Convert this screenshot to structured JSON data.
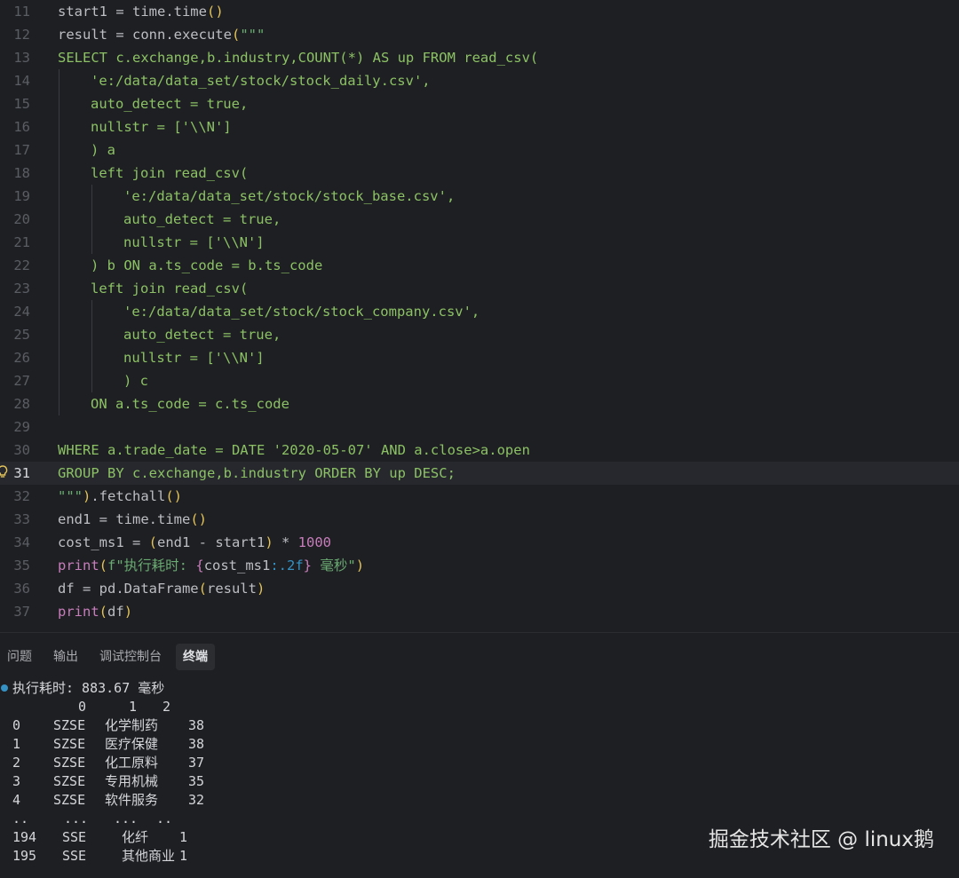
{
  "colors": {
    "keyword": "#cf8e6d",
    "string": "#6aab73",
    "number": "#2aacb8",
    "function": "#56a8f5",
    "paren": "#e3c35a",
    "default": "#bcbec4",
    "sql": "#8cc265",
    "builtin": "#c77dbb",
    "dot": "#3592c4"
  },
  "editor": {
    "lines": [
      {
        "n": "11",
        "indent": 0,
        "segs": [
          {
            "t": "start1 = time.time",
            "c": "default"
          },
          {
            "t": "()",
            "c": "paren"
          }
        ]
      },
      {
        "n": "12",
        "indent": 0,
        "segs": [
          {
            "t": "result = conn.execute",
            "c": "default"
          },
          {
            "t": "(",
            "c": "paren"
          },
          {
            "t": "\"\"\"",
            "c": "string"
          }
        ]
      },
      {
        "n": "13",
        "indent": 0,
        "segs": [
          {
            "t": "SELECT c.exchange,b.industry,COUNT(*) AS up FROM read_csv(",
            "c": "sql"
          }
        ]
      },
      {
        "n": "14",
        "indent": 1,
        "segs": [
          {
            "t": "'e:/data/data_set/stock/stock_daily.csv',",
            "c": "sql"
          }
        ]
      },
      {
        "n": "15",
        "indent": 1,
        "segs": [
          {
            "t": "auto_detect = true,",
            "c": "sql"
          }
        ]
      },
      {
        "n": "16",
        "indent": 1,
        "segs": [
          {
            "t": "nullstr = ['\\\\N']",
            "c": "sql"
          }
        ]
      },
      {
        "n": "17",
        "indent": 1,
        "segs": [
          {
            "t": ") a",
            "c": "sql"
          }
        ]
      },
      {
        "n": "18",
        "indent": 1,
        "segs": [
          {
            "t": "left join read_csv(",
            "c": "sql"
          }
        ]
      },
      {
        "n": "19",
        "indent": 2,
        "segs": [
          {
            "t": "'e:/data/data_set/stock/stock_base.csv',",
            "c": "sql"
          }
        ]
      },
      {
        "n": "20",
        "indent": 2,
        "segs": [
          {
            "t": "auto_detect = true,",
            "c": "sql"
          }
        ]
      },
      {
        "n": "21",
        "indent": 2,
        "segs": [
          {
            "t": "nullstr = ['\\\\N']",
            "c": "sql"
          }
        ]
      },
      {
        "n": "22",
        "indent": 1,
        "segs": [
          {
            "t": ") b ON a.ts_code = b.ts_code",
            "c": "sql"
          }
        ]
      },
      {
        "n": "23",
        "indent": 1,
        "segs": [
          {
            "t": "left join read_csv(",
            "c": "sql"
          }
        ]
      },
      {
        "n": "24",
        "indent": 2,
        "segs": [
          {
            "t": "'e:/data/data_set/stock/stock_company.csv',",
            "c": "sql"
          }
        ]
      },
      {
        "n": "25",
        "indent": 2,
        "segs": [
          {
            "t": "auto_detect = true,",
            "c": "sql"
          }
        ]
      },
      {
        "n": "26",
        "indent": 2,
        "segs": [
          {
            "t": "nullstr = ['\\\\N']",
            "c": "sql"
          }
        ]
      },
      {
        "n": "27",
        "indent": 2,
        "segs": [
          {
            "t": ") c",
            "c": "sql"
          }
        ]
      },
      {
        "n": "28",
        "indent": 1,
        "segs": [
          {
            "t": "ON a.ts_code = c.ts_code",
            "c": "sql"
          }
        ]
      },
      {
        "n": "29",
        "indent": 0,
        "segs": []
      },
      {
        "n": "30",
        "indent": 0,
        "segs": [
          {
            "t": "WHERE a.trade_date = DATE '2020-05-07' AND a.close>a.open",
            "c": "sql"
          }
        ]
      },
      {
        "n": "31",
        "indent": 0,
        "current": true,
        "segs": [
          {
            "t": "GROUP BY c.exchange,b.industry ORDER BY up DESC;",
            "c": "sql"
          }
        ]
      },
      {
        "n": "32",
        "indent": 0,
        "segs": [
          {
            "t": "\"\"\"",
            "c": "string"
          },
          {
            "t": ")",
            "c": "paren"
          },
          {
            "t": ".fetchall",
            "c": "default"
          },
          {
            "t": "()",
            "c": "paren"
          }
        ]
      },
      {
        "n": "33",
        "indent": 0,
        "segs": [
          {
            "t": "end1 = time.time",
            "c": "default"
          },
          {
            "t": "()",
            "c": "paren"
          }
        ]
      },
      {
        "n": "34",
        "indent": 0,
        "segs": [
          {
            "t": "cost_ms1 = ",
            "c": "default"
          },
          {
            "t": "(",
            "c": "paren"
          },
          {
            "t": "end1 - start1",
            "c": "default"
          },
          {
            "t": ")",
            "c": "paren"
          },
          {
            "t": " * ",
            "c": "default"
          },
          {
            "t": "1000",
            "c": "builtin"
          }
        ]
      },
      {
        "n": "35",
        "indent": 0,
        "segs": [
          {
            "t": "print",
            "c": "builtin"
          },
          {
            "t": "(",
            "c": "paren"
          },
          {
            "t": "f\"执行耗时: ",
            "c": "string"
          },
          {
            "t": "{",
            "c": "builtin"
          },
          {
            "t": "cost_ms1",
            "c": "default"
          },
          {
            "t": ":.2f",
            "c": "dot"
          },
          {
            "t": "}",
            "c": "builtin"
          },
          {
            "t": " 毫秒\"",
            "c": "string"
          },
          {
            "t": ")",
            "c": "paren"
          }
        ]
      },
      {
        "n": "36",
        "indent": 0,
        "segs": [
          {
            "t": "df = pd.DataFrame",
            "c": "default"
          },
          {
            "t": "(",
            "c": "paren"
          },
          {
            "t": "result",
            "c": "default"
          },
          {
            "t": ")",
            "c": "paren"
          }
        ]
      },
      {
        "n": "37",
        "indent": 0,
        "segs": [
          {
            "t": "print",
            "c": "builtin"
          },
          {
            "t": "(",
            "c": "paren"
          },
          {
            "t": "df",
            "c": "default"
          },
          {
            "t": ")",
            "c": "paren"
          }
        ]
      }
    ]
  },
  "panel": {
    "tabs": [
      {
        "label": "问题",
        "active": false
      },
      {
        "label": "输出",
        "active": false
      },
      {
        "label": "调试控制台",
        "active": false
      },
      {
        "label": "终端",
        "active": true
      }
    ]
  },
  "terminal": {
    "status_dot_color": "#3592c4",
    "timing_line": "执行耗时: 883.67 毫秒",
    "header": [
      "0",
      "1",
      "2"
    ],
    "rows": [
      [
        "0",
        "SZSE",
        "化学制药",
        "38"
      ],
      [
        "1",
        "SZSE",
        "医疗保健",
        "38"
      ],
      [
        "2",
        "SZSE",
        "化工原料",
        "37"
      ],
      [
        "3",
        "SZSE",
        "专用机械",
        "35"
      ],
      [
        "4",
        "SZSE",
        "软件服务",
        "32"
      ],
      [
        "..",
        "...",
        "...",
        ".."
      ],
      [
        "194",
        "SSE",
        "化纤",
        "1"
      ],
      [
        "195",
        "SSE",
        "其他商业",
        "1"
      ]
    ]
  },
  "watermark": "掘金技术社区 @ linux鹅"
}
